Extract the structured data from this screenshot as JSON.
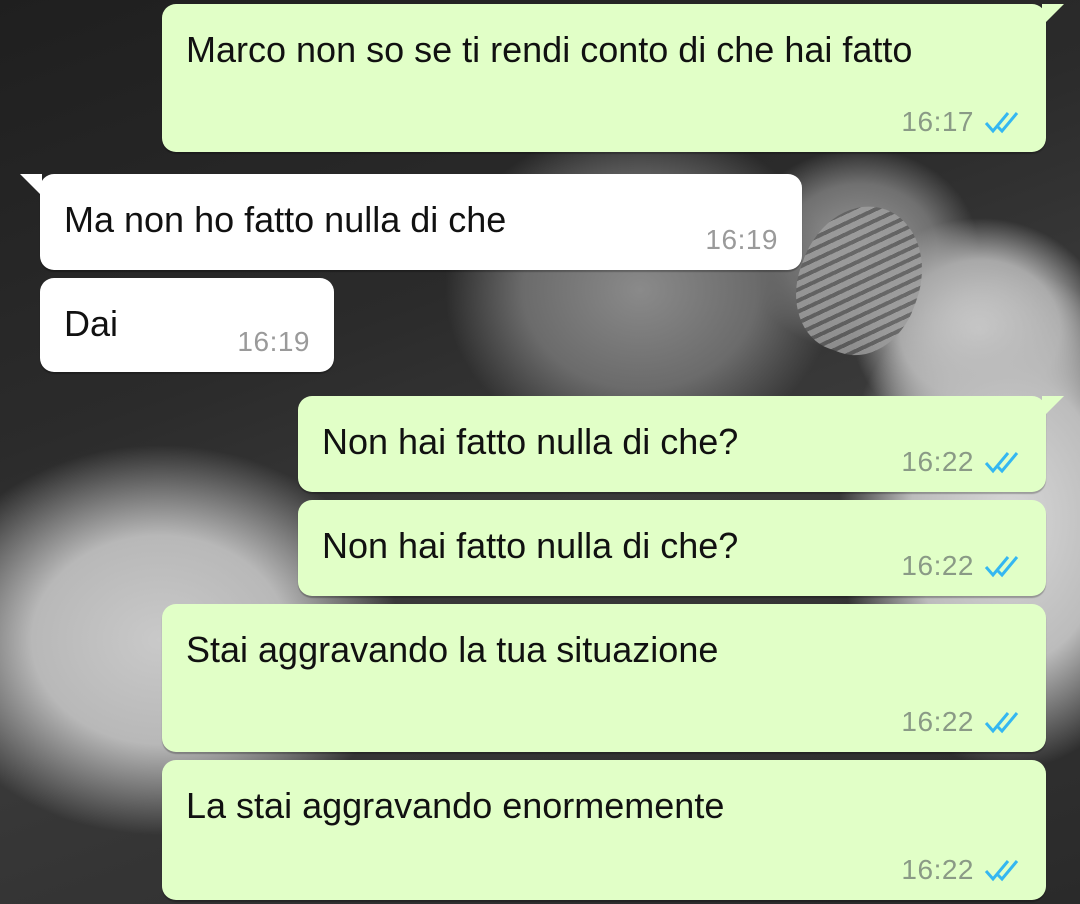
{
  "messages": [
    {
      "direction": "out",
      "text": "Marco non so se ti rendi conto di che hai fatto",
      "time": "16:17",
      "status": "read-double-check-icon"
    },
    {
      "direction": "in",
      "text": "Ma non ho fatto nulla di che",
      "time": "16:19"
    },
    {
      "direction": "in",
      "text": "Dai",
      "time": "16:19"
    },
    {
      "direction": "out",
      "text": "Non hai fatto nulla di che?",
      "time": "16:22",
      "status": "read-double-check-icon"
    },
    {
      "direction": "out",
      "text": "Non hai fatto nulla di che?",
      "time": "16:22",
      "status": "read-double-check-icon"
    },
    {
      "direction": "out",
      "text": "Stai aggravando la tua situazione",
      "time": "16:22",
      "status": "read-double-check-icon"
    },
    {
      "direction": "out",
      "text": "La stai aggravando enormemente",
      "time": "16:22",
      "status": "read-double-check-icon"
    }
  ],
  "colors": {
    "outgoing_bubble": "#e1ffc7",
    "incoming_bubble": "#ffffff",
    "read_ticks": "#34b7f1"
  }
}
